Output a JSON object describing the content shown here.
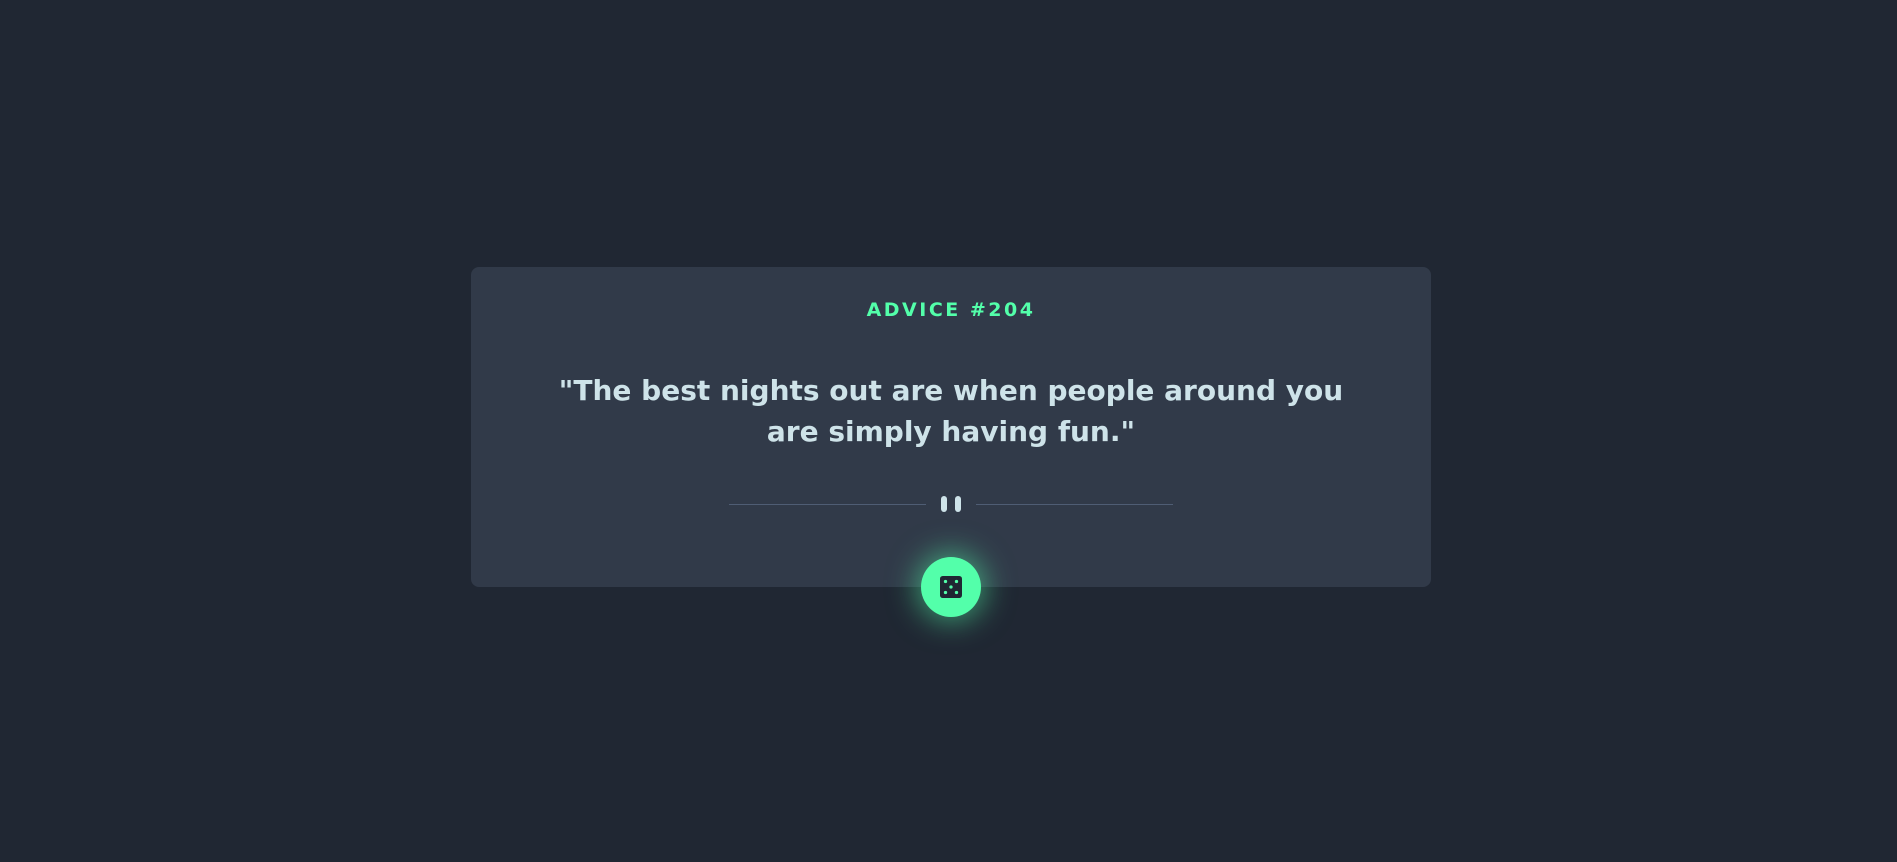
{
  "advice": {
    "id_label": "ADVICE #204",
    "quote": "\"The best nights out are when people around you are simply having fun.\""
  },
  "divider": {
    "icon": "pause-icon"
  },
  "generate_button": {
    "icon": "dice-icon"
  },
  "colors": {
    "background": "#202733",
    "card": "#313a49",
    "accent": "#53ffaa",
    "text": "#cee3e9",
    "divider_line": "#4f5d74"
  }
}
